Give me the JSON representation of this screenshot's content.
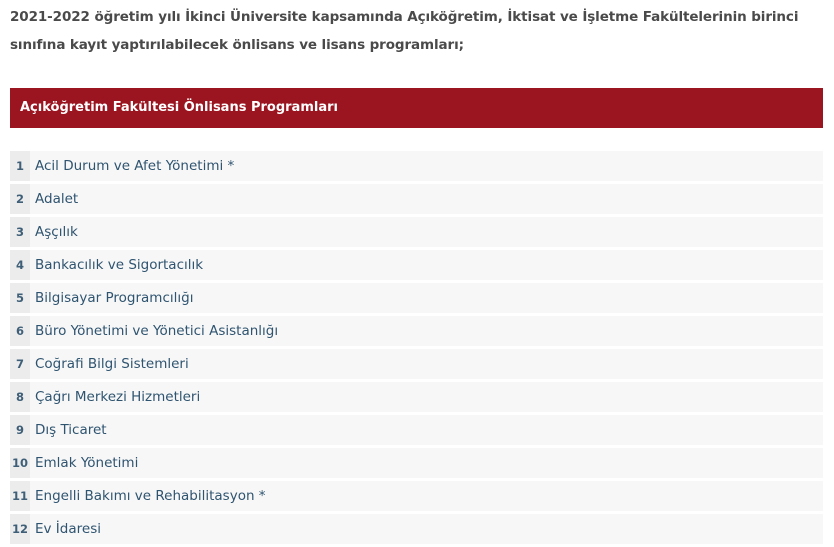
{
  "intro_text": "2021-2022 öğretim yılı İkinci Üniversite kapsamında Açıköğretim, İktisat ve İşletme Fakültelerinin birinci sınıfına kayıt yaptırılabilecek önlisans ve lisans programları;",
  "section": {
    "title": "Açıköğretim Fakültesi Önlisans Programları"
  },
  "programs": [
    {
      "num": "1",
      "name": "Acil Durum ve Afet Yönetimi *"
    },
    {
      "num": "2",
      "name": "Adalet"
    },
    {
      "num": "3",
      "name": "Aşçılık"
    },
    {
      "num": "4",
      "name": "Bankacılık ve Sigortacılık"
    },
    {
      "num": "5",
      "name": "Bilgisayar Programcılığı"
    },
    {
      "num": "6",
      "name": "Büro Yönetimi ve Yönetici Asistanlığı"
    },
    {
      "num": "7",
      "name": "Coğrafi Bilgi Sistemleri"
    },
    {
      "num": "8",
      "name": "Çağrı Merkezi Hizmetleri"
    },
    {
      "num": "9",
      "name": "Dış Ticaret"
    },
    {
      "num": "10",
      "name": "Emlak Yönetimi"
    },
    {
      "num": "11",
      "name": "Engelli Bakımı ve Rehabilitasyon *"
    },
    {
      "num": "12",
      "name": "Ev İdaresi"
    }
  ],
  "colors": {
    "header_bg": "#9b1520",
    "row_bg": "#f7f7f7",
    "num_bg": "#ececec",
    "link_text": "#2f5470"
  }
}
